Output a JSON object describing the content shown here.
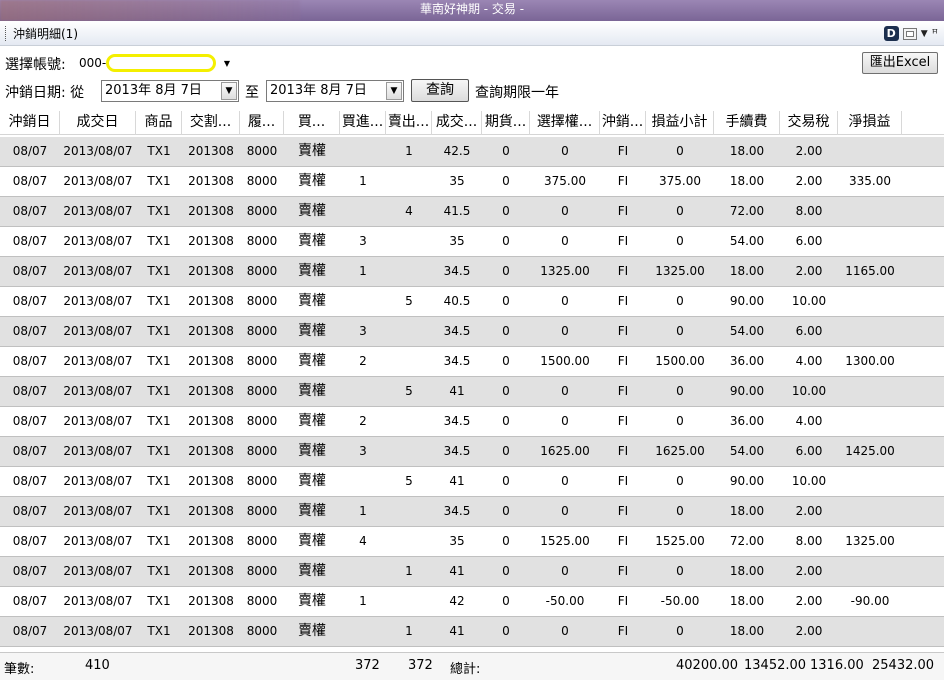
{
  "window": {
    "title": "華南好神期 - 交易 -"
  },
  "panel": {
    "title": "沖銷明細(1)"
  },
  "toolbar": {
    "account_label": "選擇帳號:",
    "account_value": "000-",
    "export_label": "匯出Excel",
    "date_label": "沖銷日期: 從",
    "date_from": "2013年  8月  7日",
    "to_label": "至",
    "date_to": "2013年  8月  7日",
    "query_label": "查詢",
    "query_note": "查詢期限一年"
  },
  "columns": [
    "沖銷日",
    "成交日",
    "商品",
    "交割...",
    "履...",
    "買...",
    "買進...",
    "賣出...",
    "成交...",
    "期貨...",
    "選擇權...",
    "沖銷...",
    "損益小計",
    "手續費",
    "交易稅",
    "淨損益"
  ],
  "rows": [
    [
      "08/07",
      "2013/08/07",
      "TX1",
      "201308",
      "8000",
      "賣權",
      "",
      "1",
      "42.5",
      "0",
      "0",
      "FI",
      "0",
      "18.00",
      "2.00",
      ""
    ],
    [
      "08/07",
      "2013/08/07",
      "TX1",
      "201308",
      "8000",
      "賣權",
      "1",
      "",
      "35",
      "0",
      "375.00",
      "FI",
      "375.00",
      "18.00",
      "2.00",
      "335.00"
    ],
    [
      "08/07",
      "2013/08/07",
      "TX1",
      "201308",
      "8000",
      "賣權",
      "",
      "4",
      "41.5",
      "0",
      "0",
      "FI",
      "0",
      "72.00",
      "8.00",
      ""
    ],
    [
      "08/07",
      "2013/08/07",
      "TX1",
      "201308",
      "8000",
      "賣權",
      "3",
      "",
      "35",
      "0",
      "0",
      "FI",
      "0",
      "54.00",
      "6.00",
      ""
    ],
    [
      "08/07",
      "2013/08/07",
      "TX1",
      "201308",
      "8000",
      "賣權",
      "1",
      "",
      "34.5",
      "0",
      "1325.00",
      "FI",
      "1325.00",
      "18.00",
      "2.00",
      "1165.00"
    ],
    [
      "08/07",
      "2013/08/07",
      "TX1",
      "201308",
      "8000",
      "賣權",
      "",
      "5",
      "40.5",
      "0",
      "0",
      "FI",
      "0",
      "90.00",
      "10.00",
      ""
    ],
    [
      "08/07",
      "2013/08/07",
      "TX1",
      "201308",
      "8000",
      "賣權",
      "3",
      "",
      "34.5",
      "0",
      "0",
      "FI",
      "0",
      "54.00",
      "6.00",
      ""
    ],
    [
      "08/07",
      "2013/08/07",
      "TX1",
      "201308",
      "8000",
      "賣權",
      "2",
      "",
      "34.5",
      "0",
      "1500.00",
      "FI",
      "1500.00",
      "36.00",
      "4.00",
      "1300.00"
    ],
    [
      "08/07",
      "2013/08/07",
      "TX1",
      "201308",
      "8000",
      "賣權",
      "",
      "5",
      "41",
      "0",
      "0",
      "FI",
      "0",
      "90.00",
      "10.00",
      ""
    ],
    [
      "08/07",
      "2013/08/07",
      "TX1",
      "201308",
      "8000",
      "賣權",
      "2",
      "",
      "34.5",
      "0",
      "0",
      "FI",
      "0",
      "36.00",
      "4.00",
      ""
    ],
    [
      "08/07",
      "2013/08/07",
      "TX1",
      "201308",
      "8000",
      "賣權",
      "3",
      "",
      "34.5",
      "0",
      "1625.00",
      "FI",
      "1625.00",
      "54.00",
      "6.00",
      "1425.00"
    ],
    [
      "08/07",
      "2013/08/07",
      "TX1",
      "201308",
      "8000",
      "賣權",
      "",
      "5",
      "41",
      "0",
      "0",
      "FI",
      "0",
      "90.00",
      "10.00",
      ""
    ],
    [
      "08/07",
      "2013/08/07",
      "TX1",
      "201308",
      "8000",
      "賣權",
      "1",
      "",
      "34.5",
      "0",
      "0",
      "FI",
      "0",
      "18.00",
      "2.00",
      ""
    ],
    [
      "08/07",
      "2013/08/07",
      "TX1",
      "201308",
      "8000",
      "賣權",
      "4",
      "",
      "35",
      "0",
      "1525.00",
      "FI",
      "1525.00",
      "72.00",
      "8.00",
      "1325.00"
    ],
    [
      "08/07",
      "2013/08/07",
      "TX1",
      "201308",
      "8000",
      "賣權",
      "",
      "1",
      "41",
      "0",
      "0",
      "FI",
      "0",
      "18.00",
      "2.00",
      ""
    ],
    [
      "08/07",
      "2013/08/07",
      "TX1",
      "201308",
      "8000",
      "賣權",
      "1",
      "",
      "42",
      "0",
      "-50.00",
      "FI",
      "-50.00",
      "18.00",
      "2.00",
      "-90.00"
    ],
    [
      "08/07",
      "2013/08/07",
      "TX1",
      "201308",
      "8000",
      "賣權",
      "",
      "1",
      "41",
      "0",
      "0",
      "FI",
      "0",
      "18.00",
      "2.00",
      ""
    ]
  ],
  "footer": {
    "count_label": "筆數:",
    "count_value": "410",
    "buy_total": "372",
    "sell_total": "372",
    "total_label": "總計:",
    "pnl_total": "40200.00",
    "fee_total": "13452.00",
    "tax_total": "1316.00",
    "net_total": "25432.00"
  },
  "colors": {
    "title_bar": "#8a75a6",
    "row_alt": "#e1e1e1",
    "highlight": "#f4ef00"
  },
  "icons": [
    "d-app-icon",
    "window-icon",
    "chevron-down-icon",
    "pin-icon"
  ]
}
